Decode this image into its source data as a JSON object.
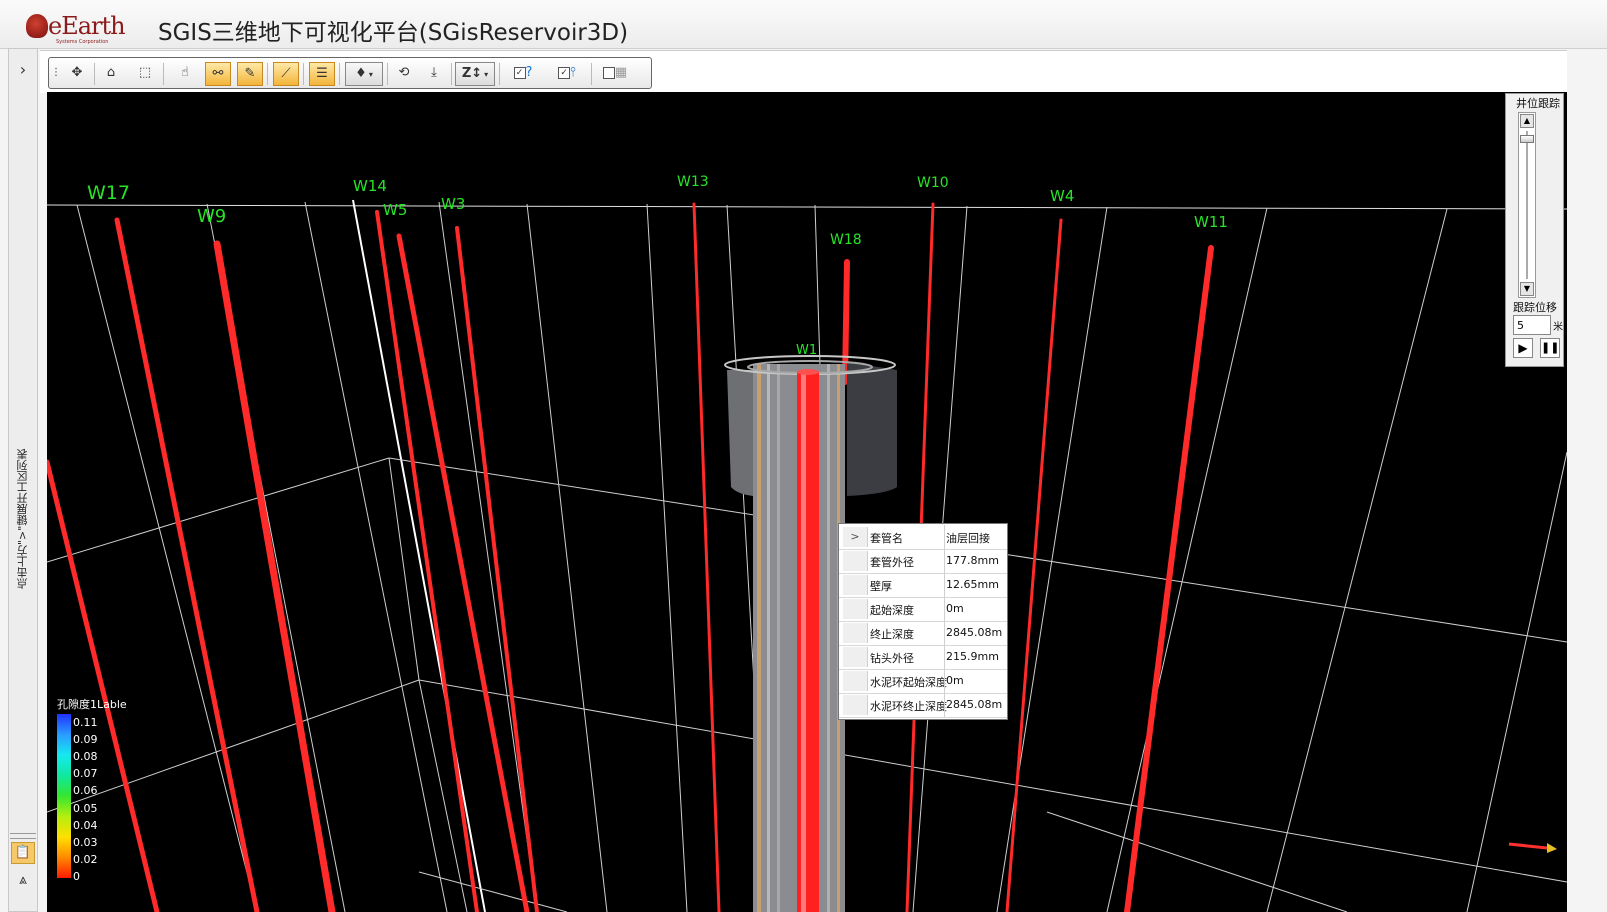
{
  "header": {
    "logo_text": "eEarth",
    "logo_sub": "Systems Corporation",
    "title": "SGIS三维地下可视化平台(SGisReservoir3D)"
  },
  "sidebar": {
    "expand_glyph": "›",
    "hint": "点击上方\">\"键展开工区列表"
  },
  "toolbar": {
    "icons": [
      "grip-icon",
      "pan-icon",
      "home-icon",
      "box-view-icon",
      "select-icon",
      "measure-link-icon",
      "pen-icon",
      "section-icon",
      "layers-icon",
      "light-dropdown-icon",
      "rotate-icon",
      "fly-icon",
      "z-scale-dropdown-icon",
      "help-checkbox-icon",
      "well-checkbox-icon",
      "calendar-checkbox-icon"
    ]
  },
  "wells": [
    {
      "name": "W17"
    },
    {
      "name": "W9"
    },
    {
      "name": "W14"
    },
    {
      "name": "W5"
    },
    {
      "name": "W3"
    },
    {
      "name": "W13"
    },
    {
      "name": "W18"
    },
    {
      "name": "W10"
    },
    {
      "name": "W4"
    },
    {
      "name": "W11"
    },
    {
      "name": "W1"
    }
  ],
  "legend": {
    "title": "孔隙度1Lable",
    "values": [
      "0.11",
      "0.09",
      "0.08",
      "0.07",
      "0.06",
      "0.05",
      "0.04",
      "0.03",
      "0.02",
      "0"
    ],
    "colors": [
      "#1f33ff",
      "#2a9bff",
      "#16e9f0",
      "#10e8a0",
      "#34e62e",
      "#b4ee10",
      "#ffe000",
      "#ff8a00",
      "#ff1a00"
    ]
  },
  "properties": {
    "expand_glyph": ">",
    "rows": [
      {
        "key": "套管名",
        "value": "油层回接"
      },
      {
        "key": "套管外径",
        "value": "177.8mm"
      },
      {
        "key": "壁厚",
        "value": "12.65mm"
      },
      {
        "key": "起始深度",
        "value": "0m"
      },
      {
        "key": "终止深度",
        "value": "2845.08m"
      },
      {
        "key": "钻头外径",
        "value": "215.9mm"
      },
      {
        "key": "水泥环起始深度",
        "value": "0m"
      },
      {
        "key": "水泥环终止深度",
        "value": "2845.08m"
      }
    ]
  },
  "tracking": {
    "title": "井位跟踪",
    "offset_label": "跟踪位移",
    "offset_value": "5",
    "unit": "米",
    "play_glyph": "▶",
    "pause_glyph": "❚❚"
  },
  "colors": {
    "well": "#ff2a2a",
    "well_label": "#27e427",
    "grid": "#cfcfcf",
    "casing": "#8a8c90"
  }
}
